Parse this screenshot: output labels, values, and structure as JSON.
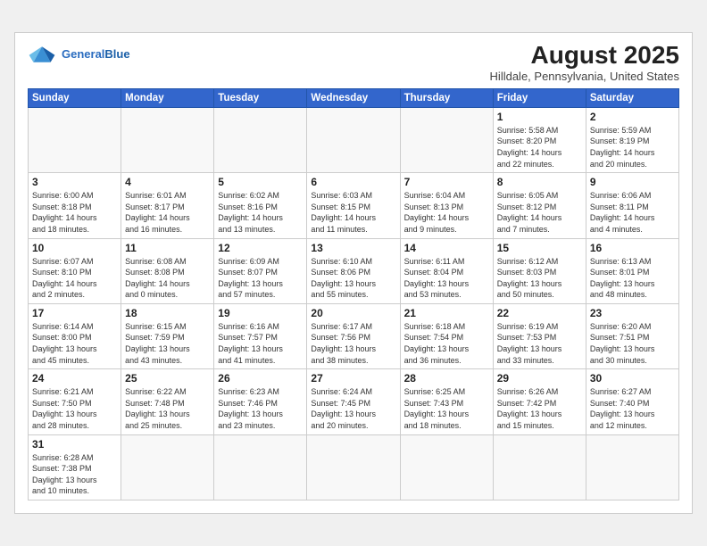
{
  "header": {
    "logo_line1": "General",
    "logo_line2": "Blue",
    "title": "August 2025",
    "subtitle": "Hilldale, Pennsylvania, United States"
  },
  "days_of_week": [
    "Sunday",
    "Monday",
    "Tuesday",
    "Wednesday",
    "Thursday",
    "Friday",
    "Saturday"
  ],
  "weeks": [
    [
      {
        "day": "",
        "info": ""
      },
      {
        "day": "",
        "info": ""
      },
      {
        "day": "",
        "info": ""
      },
      {
        "day": "",
        "info": ""
      },
      {
        "day": "",
        "info": ""
      },
      {
        "day": "1",
        "info": "Sunrise: 5:58 AM\nSunset: 8:20 PM\nDaylight: 14 hours\nand 22 minutes."
      },
      {
        "day": "2",
        "info": "Sunrise: 5:59 AM\nSunset: 8:19 PM\nDaylight: 14 hours\nand 20 minutes."
      }
    ],
    [
      {
        "day": "3",
        "info": "Sunrise: 6:00 AM\nSunset: 8:18 PM\nDaylight: 14 hours\nand 18 minutes."
      },
      {
        "day": "4",
        "info": "Sunrise: 6:01 AM\nSunset: 8:17 PM\nDaylight: 14 hours\nand 16 minutes."
      },
      {
        "day": "5",
        "info": "Sunrise: 6:02 AM\nSunset: 8:16 PM\nDaylight: 14 hours\nand 13 minutes."
      },
      {
        "day": "6",
        "info": "Sunrise: 6:03 AM\nSunset: 8:15 PM\nDaylight: 14 hours\nand 11 minutes."
      },
      {
        "day": "7",
        "info": "Sunrise: 6:04 AM\nSunset: 8:13 PM\nDaylight: 14 hours\nand 9 minutes."
      },
      {
        "day": "8",
        "info": "Sunrise: 6:05 AM\nSunset: 8:12 PM\nDaylight: 14 hours\nand 7 minutes."
      },
      {
        "day": "9",
        "info": "Sunrise: 6:06 AM\nSunset: 8:11 PM\nDaylight: 14 hours\nand 4 minutes."
      }
    ],
    [
      {
        "day": "10",
        "info": "Sunrise: 6:07 AM\nSunset: 8:10 PM\nDaylight: 14 hours\nand 2 minutes."
      },
      {
        "day": "11",
        "info": "Sunrise: 6:08 AM\nSunset: 8:08 PM\nDaylight: 14 hours\nand 0 minutes."
      },
      {
        "day": "12",
        "info": "Sunrise: 6:09 AM\nSunset: 8:07 PM\nDaylight: 13 hours\nand 57 minutes."
      },
      {
        "day": "13",
        "info": "Sunrise: 6:10 AM\nSunset: 8:06 PM\nDaylight: 13 hours\nand 55 minutes."
      },
      {
        "day": "14",
        "info": "Sunrise: 6:11 AM\nSunset: 8:04 PM\nDaylight: 13 hours\nand 53 minutes."
      },
      {
        "day": "15",
        "info": "Sunrise: 6:12 AM\nSunset: 8:03 PM\nDaylight: 13 hours\nand 50 minutes."
      },
      {
        "day": "16",
        "info": "Sunrise: 6:13 AM\nSunset: 8:01 PM\nDaylight: 13 hours\nand 48 minutes."
      }
    ],
    [
      {
        "day": "17",
        "info": "Sunrise: 6:14 AM\nSunset: 8:00 PM\nDaylight: 13 hours\nand 45 minutes."
      },
      {
        "day": "18",
        "info": "Sunrise: 6:15 AM\nSunset: 7:59 PM\nDaylight: 13 hours\nand 43 minutes."
      },
      {
        "day": "19",
        "info": "Sunrise: 6:16 AM\nSunset: 7:57 PM\nDaylight: 13 hours\nand 41 minutes."
      },
      {
        "day": "20",
        "info": "Sunrise: 6:17 AM\nSunset: 7:56 PM\nDaylight: 13 hours\nand 38 minutes."
      },
      {
        "day": "21",
        "info": "Sunrise: 6:18 AM\nSunset: 7:54 PM\nDaylight: 13 hours\nand 36 minutes."
      },
      {
        "day": "22",
        "info": "Sunrise: 6:19 AM\nSunset: 7:53 PM\nDaylight: 13 hours\nand 33 minutes."
      },
      {
        "day": "23",
        "info": "Sunrise: 6:20 AM\nSunset: 7:51 PM\nDaylight: 13 hours\nand 30 minutes."
      }
    ],
    [
      {
        "day": "24",
        "info": "Sunrise: 6:21 AM\nSunset: 7:50 PM\nDaylight: 13 hours\nand 28 minutes."
      },
      {
        "day": "25",
        "info": "Sunrise: 6:22 AM\nSunset: 7:48 PM\nDaylight: 13 hours\nand 25 minutes."
      },
      {
        "day": "26",
        "info": "Sunrise: 6:23 AM\nSunset: 7:46 PM\nDaylight: 13 hours\nand 23 minutes."
      },
      {
        "day": "27",
        "info": "Sunrise: 6:24 AM\nSunset: 7:45 PM\nDaylight: 13 hours\nand 20 minutes."
      },
      {
        "day": "28",
        "info": "Sunrise: 6:25 AM\nSunset: 7:43 PM\nDaylight: 13 hours\nand 18 minutes."
      },
      {
        "day": "29",
        "info": "Sunrise: 6:26 AM\nSunset: 7:42 PM\nDaylight: 13 hours\nand 15 minutes."
      },
      {
        "day": "30",
        "info": "Sunrise: 6:27 AM\nSunset: 7:40 PM\nDaylight: 13 hours\nand 12 minutes."
      }
    ],
    [
      {
        "day": "31",
        "info": "Sunrise: 6:28 AM\nSunset: 7:38 PM\nDaylight: 13 hours\nand 10 minutes."
      },
      {
        "day": "",
        "info": ""
      },
      {
        "day": "",
        "info": ""
      },
      {
        "day": "",
        "info": ""
      },
      {
        "day": "",
        "info": ""
      },
      {
        "day": "",
        "info": ""
      },
      {
        "day": "",
        "info": ""
      }
    ]
  ]
}
